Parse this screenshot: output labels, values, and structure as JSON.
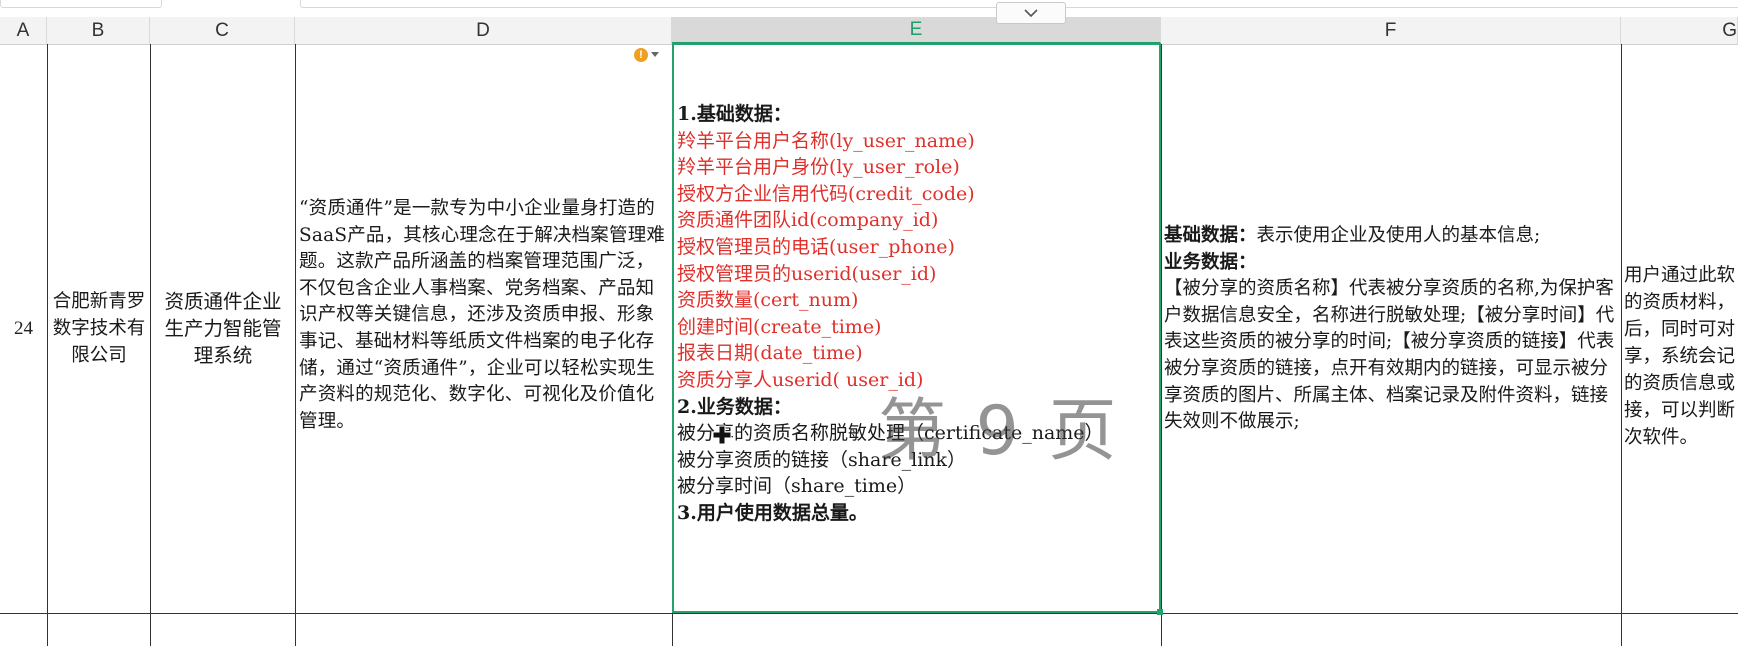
{
  "columns": [
    "A",
    "B",
    "C",
    "D",
    "E",
    "F",
    "G"
  ],
  "selected_column": "E",
  "row": {
    "number": "24",
    "company": "合肥新青罗数字技术有限公司",
    "software": "资质通件企业生产力智能管理系统",
    "description": "“资质通件”是一款专为中小企业量身打造的SaaS产品，其核心理念在于解决档案管理难题。这款产品所涵盖的档案管理范围广泛，不仅包含企业人事档案、党务档案、产品知识产权等关键信息，还涉及资质申报、形象事记、基础材料等纸质文件档案的电子化存储，通过“资质通件”，企业可以轻松实现生产资料的规范化、数字化、可视化及价值化管理。",
    "data_items": [
      {
        "text": "1.基础数据：",
        "style": "bold"
      },
      {
        "text": "羚羊平台用户名称(ly_user_name)",
        "style": "red"
      },
      {
        "text": "羚羊平台用户身份(ly_user_role)",
        "style": "red"
      },
      {
        "text": "授权方企业信用代码(credit_code)",
        "style": "red"
      },
      {
        "text": "资质通件团队id(company_id)",
        "style": "red"
      },
      {
        "text": "授权管理员的电话(user_phone)",
        "style": "red"
      },
      {
        "text": "授权管理员的userid(user_id)",
        "style": "red"
      },
      {
        "text": "资质数量(cert_num)",
        "style": "red"
      },
      {
        "text": "创建时间(create_time)",
        "style": "red"
      },
      {
        "text": "报表日期(date_time)",
        "style": "red"
      },
      {
        "text": "资质分享人userid( user_id)",
        "style": "red"
      },
      {
        "text": "2.业务数据：",
        "style": "bold"
      },
      {
        "text": "被分享的资质名称脱敏处理（certificate_name）",
        "style": "normal"
      },
      {
        "text": "被分享资质的链接（share_link）",
        "style": "normal"
      },
      {
        "text": "被分享时间（share_time）",
        "style": "normal"
      },
      {
        "text": "3.用户使用数据总量。",
        "style": "bold"
      }
    ],
    "explanation": {
      "basic_label": "基础数据：",
      "basic_text": "表示使用企业及使用人的基本信息;",
      "business_label": "业务数据：",
      "business_text": "【被分享的资质名称】代表被分享资质的名称,为保护客户数据信息安全，名称进行脱敏处理;【被分享时间】代表这些资质的被分享的时间;【被分享资质的链接】代表被分享资质的链接，点开有效期内的链接，可显示被分享资质的图片、所属主体、档案记录及附件资料，链接失效则不做展示;"
    },
    "usage_lines": [
      "用户通过此软",
      "的资质材料，",
      "后，同时可对",
      "享，系统会记",
      "的资质信息或",
      "接，可以判断",
      "次软件。"
    ]
  },
  "watermark": "第 9 页",
  "icons": {
    "warning": "warning-icon",
    "collapse": "chevron-down-icon",
    "cursor": "move-cursor-icon"
  },
  "colors": {
    "accent": "#21a36b",
    "red_text": "#e0302b",
    "warning": "#f0a020"
  }
}
